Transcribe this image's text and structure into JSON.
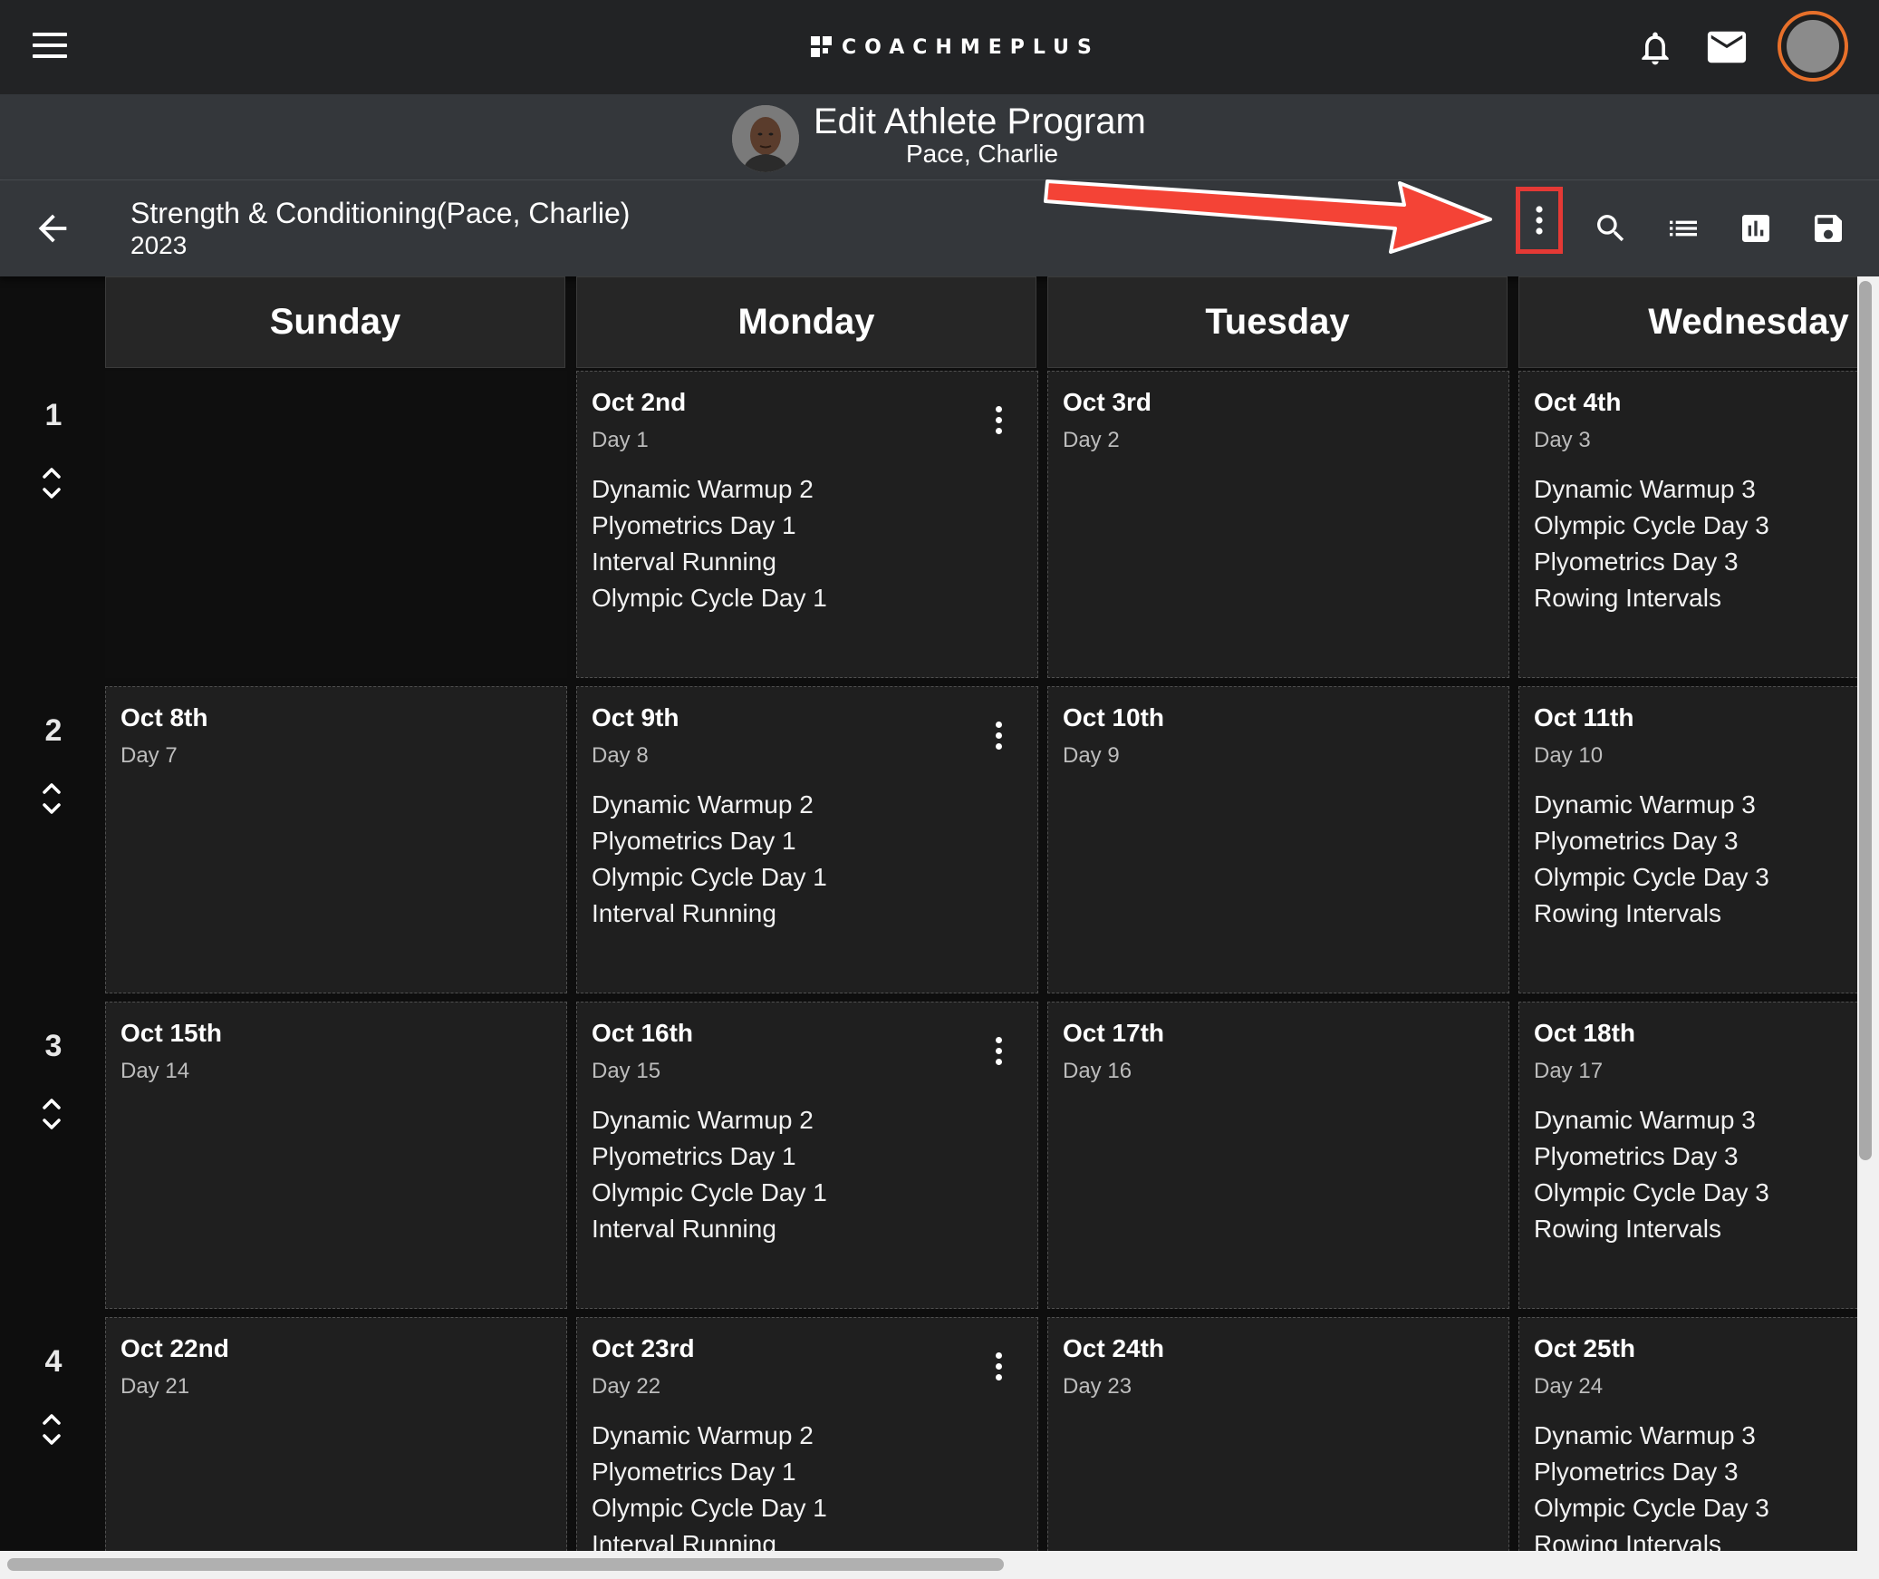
{
  "topbar": {
    "brand": "COACHMEPLUS",
    "icons": [
      "menu-icon",
      "bell-icon",
      "mail-icon",
      "avatar"
    ]
  },
  "page": {
    "title": "Edit Athlete Program",
    "athlete": "Pace, Charlie"
  },
  "toolbar": {
    "program_name": "Strength & Conditioning(Pace, Charlie)",
    "year": "2023",
    "icons": [
      "back-arrow-icon",
      "more-vert-icon",
      "search-icon",
      "list-icon",
      "bar-chart-icon",
      "save-icon"
    ],
    "highlight_color": "#e53935"
  },
  "calendar": {
    "days": [
      "Sunday",
      "Monday",
      "Tuesday",
      "Wednesday"
    ],
    "weeks": [
      {
        "label": "1",
        "cells": [
          null,
          {
            "date": "Oct 2nd",
            "day": "Day 1",
            "items": [
              "Dynamic Warmup 2",
              "Plyometrics Day 1",
              "Interval Running",
              "Olympic Cycle Day 1"
            ]
          },
          {
            "date": "Oct 3rd",
            "day": "Day 2",
            "items": []
          },
          {
            "date": "Oct 4th",
            "day": "Day 3",
            "items": [
              "Dynamic Warmup 3",
              "Olympic Cycle Day 3",
              "Plyometrics Day 3",
              "Rowing Intervals"
            ]
          }
        ]
      },
      {
        "label": "2",
        "cells": [
          {
            "date": "Oct 8th",
            "day": "Day 7",
            "items": []
          },
          {
            "date": "Oct 9th",
            "day": "Day 8",
            "items": [
              "Dynamic Warmup 2",
              "Plyometrics Day 1",
              "Olympic Cycle Day 1",
              "Interval Running"
            ]
          },
          {
            "date": "Oct 10th",
            "day": "Day 9",
            "items": []
          },
          {
            "date": "Oct 11th",
            "day": "Day 10",
            "items": [
              "Dynamic Warmup 3",
              "Plyometrics Day 3",
              "Olympic Cycle Day 3",
              "Rowing Intervals"
            ]
          }
        ]
      },
      {
        "label": "3",
        "cells": [
          {
            "date": "Oct 15th",
            "day": "Day 14",
            "items": []
          },
          {
            "date": "Oct 16th",
            "day": "Day 15",
            "items": [
              "Dynamic Warmup 2",
              "Plyometrics Day 1",
              "Olympic Cycle Day 1",
              "Interval Running"
            ]
          },
          {
            "date": "Oct 17th",
            "day": "Day 16",
            "items": []
          },
          {
            "date": "Oct 18th",
            "day": "Day 17",
            "items": [
              "Dynamic Warmup 3",
              "Plyometrics Day 3",
              "Olympic Cycle Day 3",
              "Rowing Intervals"
            ]
          }
        ]
      },
      {
        "label": "4",
        "cells": [
          {
            "date": "Oct 22nd",
            "day": "Day 21",
            "items": []
          },
          {
            "date": "Oct 23rd",
            "day": "Day 22",
            "items": [
              "Dynamic Warmup 2",
              "Plyometrics Day 1",
              "Olympic Cycle Day 1",
              "Interval Running"
            ]
          },
          {
            "date": "Oct 24th",
            "day": "Day 23",
            "items": []
          },
          {
            "date": "Oct 25th",
            "day": "Day 24",
            "items": [
              "Dynamic Warmup 3",
              "Plyometrics Day 3",
              "Olympic Cycle Day 3",
              "Rowing Intervals"
            ]
          }
        ]
      }
    ]
  },
  "annotation": {
    "color": "#f44336"
  }
}
